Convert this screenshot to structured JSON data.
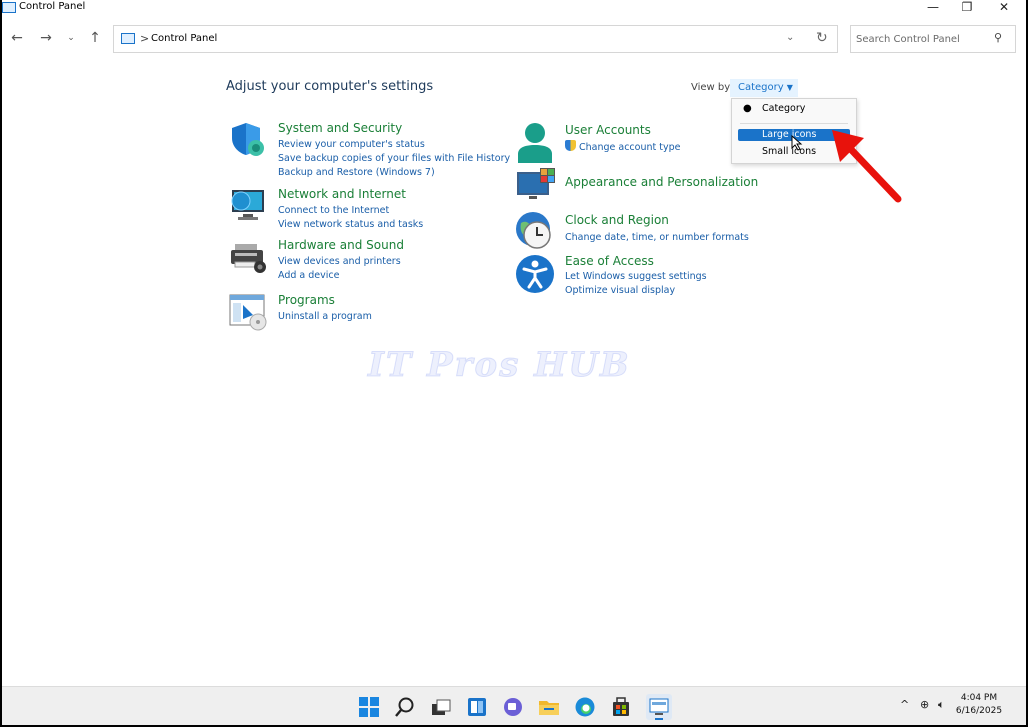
{
  "window": {
    "title": "Control Panel"
  },
  "address": {
    "crumb": "Control Panel",
    "separator": ">"
  },
  "search": {
    "placeholder": "Search Control Panel"
  },
  "main": {
    "heading": "Adjust your computer's settings",
    "view_by_label": "View by:",
    "view_by_value": "Category"
  },
  "categories": [
    {
      "title": "System and Security",
      "links": [
        "Review your computer's status",
        "Save backup copies of your files with File History",
        "Backup and Restore (Windows 7)"
      ]
    },
    {
      "title": "Network and Internet",
      "links": [
        "Connect to the Internet",
        "View network status and tasks"
      ]
    },
    {
      "title": "Hardware and Sound",
      "links": [
        "View devices and printers",
        "Add a device"
      ]
    },
    {
      "title": "Programs",
      "links": [
        "Uninstall a program"
      ]
    },
    {
      "title": "User Accounts",
      "links": [
        "Change account type"
      ]
    },
    {
      "title": "Appearance and Personalization",
      "links": []
    },
    {
      "title": "Clock and Region",
      "links": [
        "Change date, time, or number formats"
      ]
    },
    {
      "title": "Ease of Access",
      "links": [
        "Let Windows suggest settings",
        "Optimize visual display"
      ]
    }
  ],
  "view_menu": {
    "items": [
      "Category",
      "Large icons",
      "Small icons"
    ],
    "checked": "Category",
    "highlighted": "Large icons"
  },
  "watermark": "IT Pros HUB",
  "taskbar": {
    "time": "4:04 PM",
    "date": "6/16/2025"
  },
  "colors": {
    "accent": "#1a73c9",
    "category_title": "#1a7f37",
    "link": "#1a5ea8",
    "annotation_arrow": "#e8120c"
  }
}
